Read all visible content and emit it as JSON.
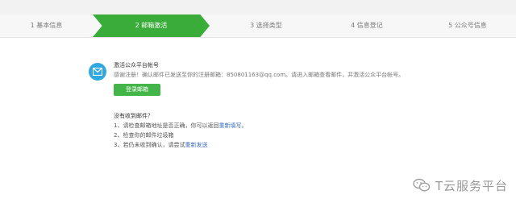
{
  "steps": [
    {
      "label": "1 基本信息"
    },
    {
      "label": "2 邮箱激活"
    },
    {
      "label": "3 选择类型"
    },
    {
      "label": "4 信息登记"
    },
    {
      "label": "5 公众号信息"
    }
  ],
  "message": {
    "title": "激活公众平台帐号",
    "desc": "感谢注册！确认邮件已发送至你的注册邮箱：850801163@qq.com。请进入邮箱查看邮件，并激活公众平台帐号。",
    "login_button": "登录邮箱"
  },
  "help": {
    "title": "没有收到邮件？",
    "line1_prefix": "1、请检查邮箱地址是否正确，你可以返回",
    "line1_link": "重新填写",
    "line1_suffix": "。",
    "line2": "2、检查你的邮件垃圾箱",
    "line3_prefix": "3、若仍未收到确认，请尝试",
    "line3_link": "重新发送"
  },
  "watermark": {
    "text": "T云服务平台",
    "icon": "wechat-icon"
  },
  "colors": {
    "active_step": "#3aac3a",
    "button": "#44b549",
    "link": "#3a6dbf",
    "mail_icon_bg": "#2fa7e0"
  }
}
